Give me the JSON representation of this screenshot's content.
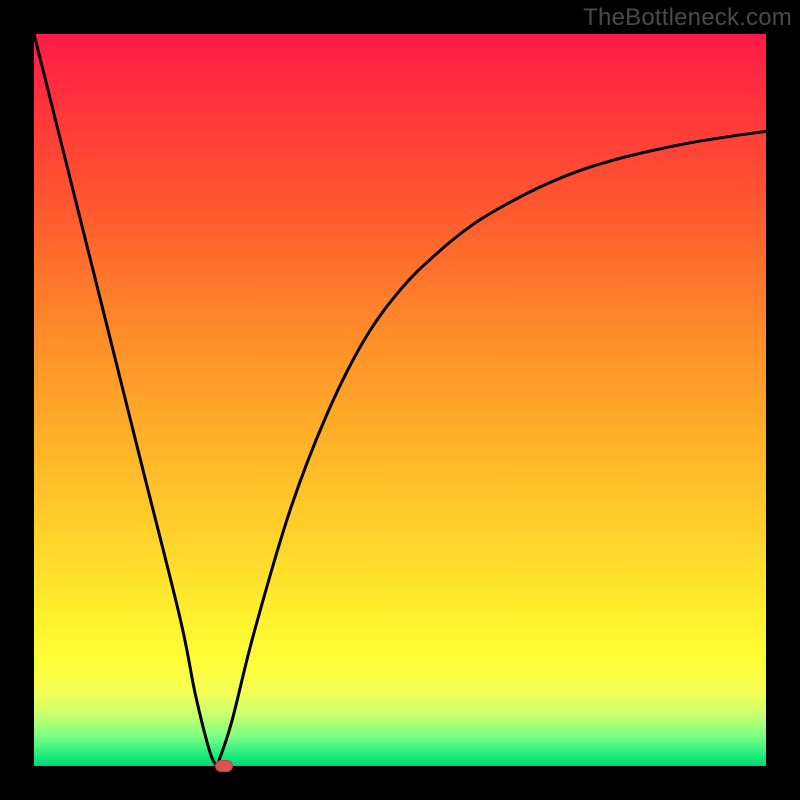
{
  "watermark": "TheBottleneck.com",
  "chart_data": {
    "type": "line",
    "title": "",
    "xlabel": "",
    "ylabel": "",
    "xlim": [
      0,
      100
    ],
    "ylim": [
      0,
      100
    ],
    "x_optimum": 25,
    "marker": {
      "x": 26,
      "y": 0
    },
    "series": [
      {
        "name": "left-branch",
        "x": [
          0,
          5,
          10,
          15,
          20,
          22,
          24,
          25
        ],
        "values": [
          100,
          80,
          60,
          40,
          20,
          10,
          2,
          0
        ]
      },
      {
        "name": "right-branch",
        "x": [
          25,
          27,
          30,
          35,
          40,
          45,
          50,
          55,
          60,
          65,
          70,
          75,
          80,
          85,
          90,
          95,
          100
        ],
        "values": [
          0,
          6,
          18,
          35,
          48,
          58,
          65,
          70,
          74,
          77,
          79.5,
          81.5,
          83,
          84.2,
          85.2,
          86,
          86.7
        ]
      }
    ],
    "gradient_stops": [
      {
        "pos": 0,
        "color": "#ff1a46"
      },
      {
        "pos": 25,
        "color": "#ff5c2e"
      },
      {
        "pos": 55,
        "color": "#ffb028"
      },
      {
        "pos": 80,
        "color": "#fff12f"
      },
      {
        "pos": 93,
        "color": "#c8ff70"
      },
      {
        "pos": 100,
        "color": "#05d673"
      }
    ]
  }
}
